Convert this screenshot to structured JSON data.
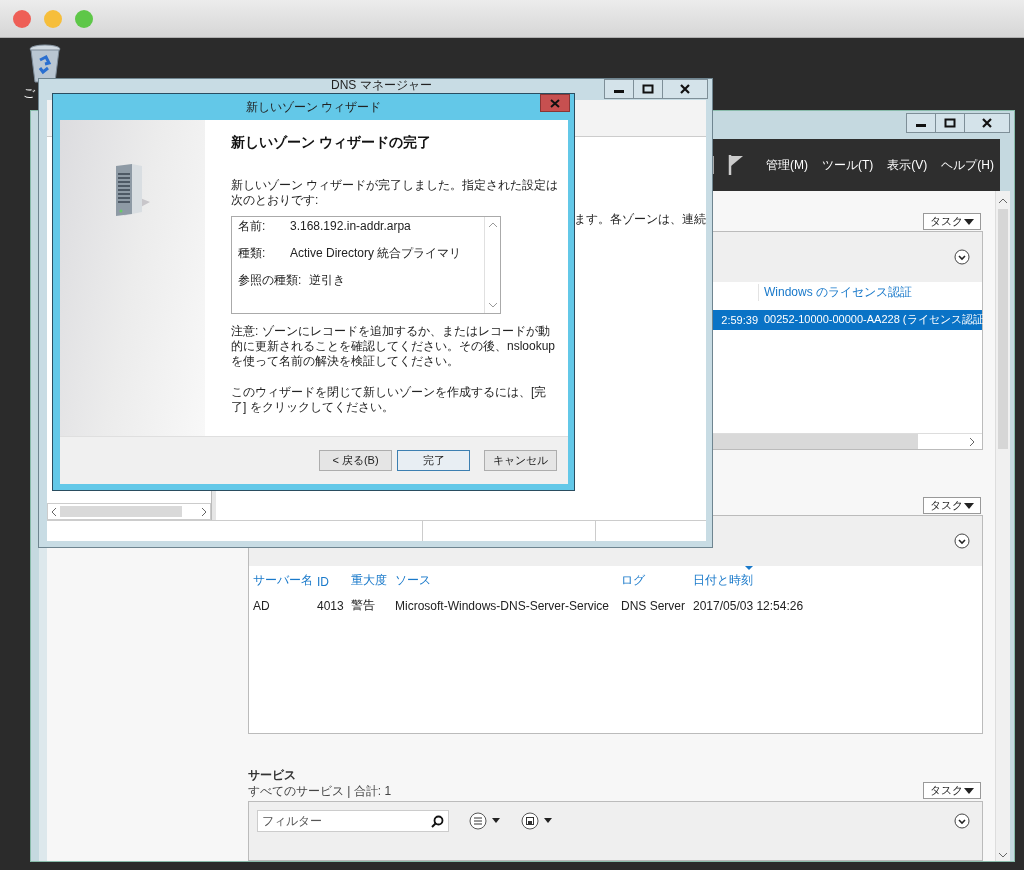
{
  "desktop": {
    "icons": [
      {
        "label": "ご"
      }
    ]
  },
  "server_manager": {
    "menu": [
      "管理(M)",
      "ツール(T)",
      "表示(V)",
      "ヘルプ(H)"
    ],
    "licensing_panel": {
      "task_button": "タスク",
      "columns": [
        {
          "label": "Windows のライセンス認証"
        }
      ],
      "rows": [
        {
          "time": "2:59:39",
          "license": "00252-10000-00000-AA228 (ライセンス認証",
          "selected": true
        }
      ]
    },
    "events_panel": {
      "task_button": "タスク",
      "columns": [
        {
          "label": "サーバー名",
          "sorted": false
        },
        {
          "label": "ID",
          "sorted": false
        },
        {
          "label": "重大度",
          "sorted": false
        },
        {
          "label": "ソース",
          "sorted": false
        },
        {
          "label": "ログ",
          "sorted": false
        },
        {
          "label": "日付と時刻",
          "sorted": true
        }
      ],
      "rows": [
        {
          "cells": [
            "AD",
            "4013",
            "警告",
            "Microsoft-Windows-DNS-Server-Service",
            "DNS Server",
            "2017/05/03 12:54:26"
          ],
          "selected": false
        }
      ]
    },
    "services_panel": {
      "title": "サービス",
      "subtitle": "すべてのサービス | 合計: 1",
      "task_button": "タスク",
      "filter": {
        "placeholder": "フィルター"
      }
    }
  },
  "dns_manager": {
    "title": "DNS マネージャー",
    "description": "ます。各ゾーンは、連続"
  },
  "wizard": {
    "title": "新しいゾーン ウィザード",
    "heading": "新しいゾーン ウィザードの完了",
    "intro": "新しいゾーン ウィザードが完了しました。指定された設定は次のとおりです:",
    "summary": [
      {
        "label": "名前:",
        "value": "3.168.192.in-addr.arpa"
      },
      {
        "label": "種類:",
        "value": "Active Directory 統合プライマリ"
      },
      {
        "label": "参照の種類:",
        "value": "逆引き"
      }
    ],
    "note": "注意: ゾーンにレコードを追加するか、またはレコードが動的に更新されることを確認してください。その後、nslookup を使って名前の解決を検証してください。",
    "closing": "このウィザードを閉じて新しいゾーンを作成するには、[完了] をクリックしてください。",
    "buttons": [
      {
        "label": "< 戻る(B)",
        "default": false
      },
      {
        "label": "完了",
        "default": true
      },
      {
        "label": "キャンセル",
        "default": false
      }
    ]
  }
}
